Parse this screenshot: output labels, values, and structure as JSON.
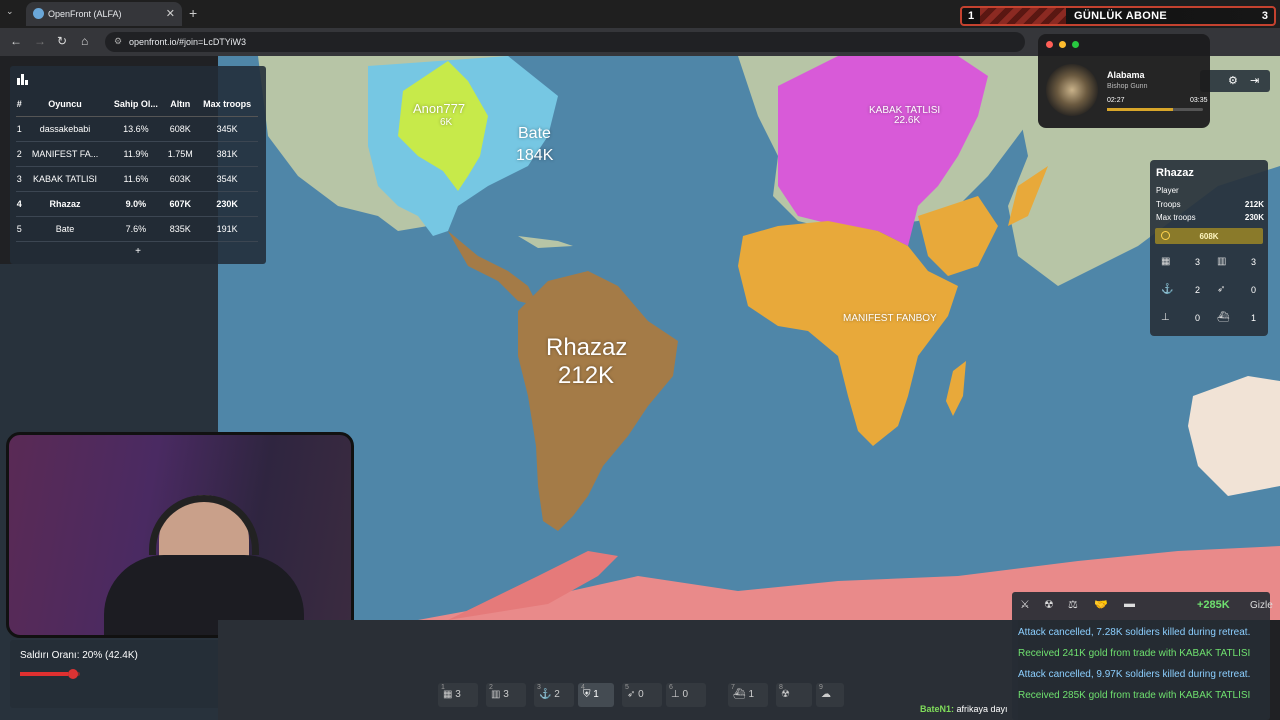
{
  "browser": {
    "tab_title": "OpenFront (ALFA)",
    "url": "openfront.io/#join=LcDTYiW3"
  },
  "banner": {
    "left_number": "1",
    "title": "GÜNLÜK ABONE",
    "right_number": "3"
  },
  "music": {
    "title": "Alabama",
    "artist": "Bishop Gunn",
    "elapsed": "02:27",
    "total": "03:35",
    "progress": 0.69
  },
  "leaderboard": {
    "headers": [
      "#",
      "Oyuncu",
      "Sahip Ol...",
      "Altın",
      "Max troops"
    ],
    "rows": [
      [
        "1",
        "dassakebabi",
        "13.6%",
        "608K",
        "345K"
      ],
      [
        "2",
        "MANIFEST FA...",
        "11.9%",
        "1.75M",
        "381K"
      ],
      [
        "3",
        "KABAK TATLISI",
        "11.6%",
        "603K",
        "354K"
      ],
      [
        "4",
        "Rhazaz",
        "9.0%",
        "607K",
        "230K"
      ],
      [
        "5",
        "Bate",
        "7.6%",
        "835K",
        "191K"
      ]
    ],
    "more": "+"
  },
  "map_labels": {
    "anon": "Anon777",
    "anon_troops": "6K",
    "bate": "Bate",
    "bate_troops": "184K",
    "kabak": "KABAK TATLISI",
    "kabak_troops": "22.6K",
    "manifest": "MANIFEST FANBOY",
    "rhazaz": "Rhazaz",
    "rhazaz_troops": "212K"
  },
  "player_panel": {
    "name": "Rhazaz",
    "type": "Player",
    "troops_label": "Troops",
    "troops": "212K",
    "max_troops_label": "Max troops",
    "max_troops": "230K",
    "gold": "608K",
    "stats": [
      "3",
      "3",
      "2",
      "0",
      "0",
      "1"
    ]
  },
  "attack": {
    "label": "Saldırı Oranı: 20% (42.4K)",
    "ratio": 0.2
  },
  "build_bar": [
    {
      "hotkey": "1",
      "count": "3"
    },
    {
      "hotkey": "2",
      "count": "3"
    },
    {
      "hotkey": "3",
      "count": "2"
    },
    {
      "hotkey": "4",
      "count": "1"
    },
    {
      "hotkey": "5",
      "count": "0"
    },
    {
      "hotkey": "6",
      "count": "0"
    },
    {
      "hotkey": "7",
      "count": "1"
    },
    {
      "hotkey": "8",
      "count": ""
    },
    {
      "hotkey": "9",
      "count": ""
    }
  ],
  "events": {
    "gold_gain": "+285K",
    "hide_label": "Gizle",
    "messages": [
      "Attack cancelled, 7.28K soldiers killed during retreat.",
      "Received 241K gold from trade with KABAK TATLISI",
      "Attack cancelled, 9.97K soldiers killed during retreat.",
      "Received 285K gold from trade with KABAK TATLISI"
    ]
  },
  "chat": {
    "user": "BateN1:",
    "message": "afrikaya dayı"
  },
  "colors": {
    "ocean": "#4f86a8",
    "rhazaz": "#a47b47",
    "manifest": "#e8a93a",
    "kabak": "#d85ad8",
    "bate": "#76c7e3",
    "anon": "#c7ea4a",
    "neutral": "#b7c5a6"
  }
}
